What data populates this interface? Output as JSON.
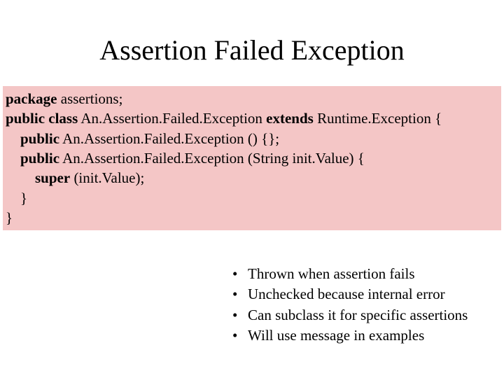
{
  "title": "Assertion Failed Exception",
  "code": {
    "l1_kw": "package",
    "l1_rest": " assertions;",
    "l2_kw1": "public class",
    "l2_mid": " An.Assertion.Failed.Exception ",
    "l2_kw2": "extends",
    "l2_end": " Runtime.Exception {",
    "l3_pre": "    ",
    "l3_kw": "public",
    "l3_rest": " An.Assertion.Failed.Exception () {};",
    "l4_pre": "    ",
    "l4_kw": "public",
    "l4_rest": " An.Assertion.Failed.Exception (String init.Value) {",
    "l5_pre": "        ",
    "l5_kw": "super",
    "l5_rest": " (init.Value);",
    "l6": "    }",
    "l7": "}"
  },
  "bullets": [
    "Thrown when assertion fails",
    "Unchecked because internal error",
    "Can subclass it for specific assertions",
    "Will use message in examples"
  ]
}
